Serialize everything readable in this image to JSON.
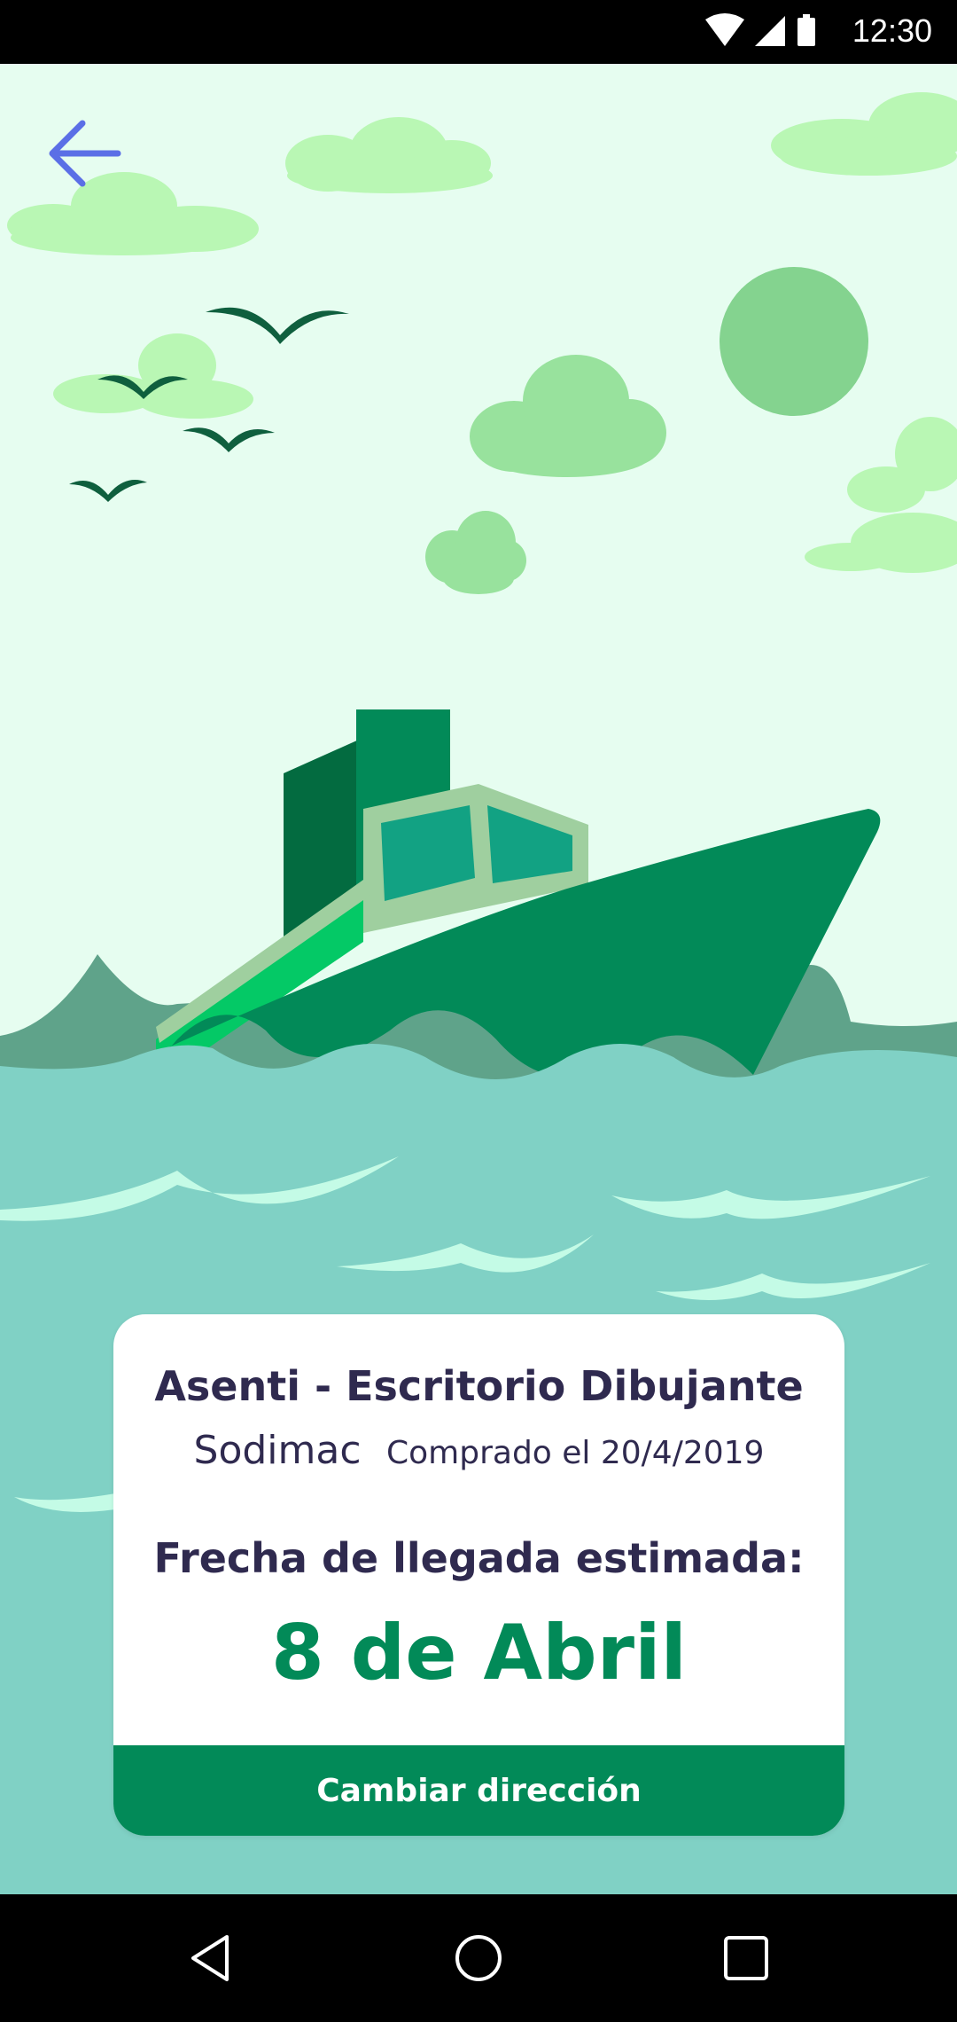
{
  "status_bar": {
    "time": "12:30",
    "icons": [
      "wifi-icon",
      "cell-signal-icon",
      "battery-icon"
    ]
  },
  "header": {
    "back_icon": "arrow-left-icon"
  },
  "card": {
    "product_name": "Asenti - Escritorio Dibujante",
    "store": "Sodimac",
    "purchase_date": "Comprado el 20/4/2019",
    "eta_label": "Frecha de llegada estimada:",
    "eta_date": "8 de Abril",
    "button_label": "Cambiar dirección"
  },
  "nav_bar": {
    "icons": [
      "back-triangle-icon",
      "home-circle-icon",
      "recents-square-icon"
    ]
  },
  "colors": {
    "accent": "#028a58",
    "back_arrow": "#5b6fe6",
    "sky": "#e6fdf0",
    "sea": "#80d1c5",
    "text": "#2f2a4f"
  }
}
